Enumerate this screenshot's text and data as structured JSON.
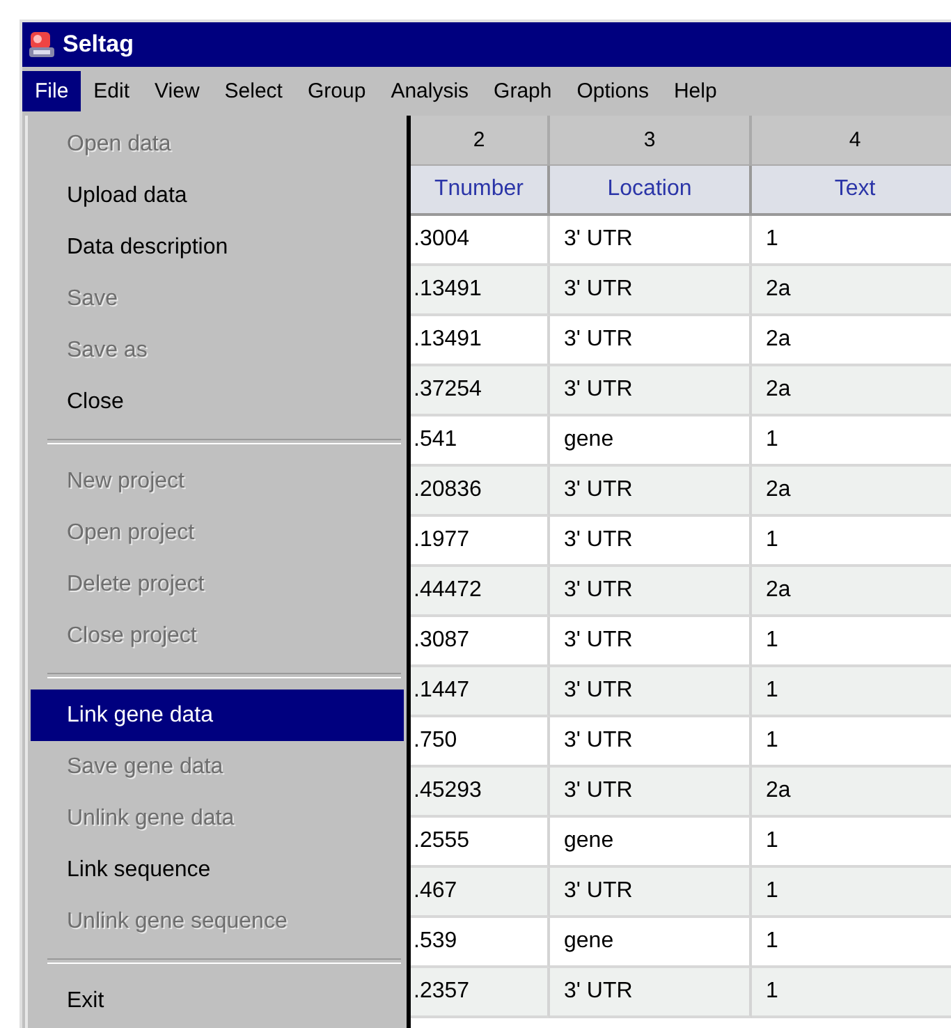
{
  "window": {
    "title": "Seltag"
  },
  "menubar": [
    {
      "label": "File",
      "selected": true
    },
    {
      "label": "Edit",
      "selected": false
    },
    {
      "label": "View",
      "selected": false
    },
    {
      "label": "Select",
      "selected": false
    },
    {
      "label": "Group",
      "selected": false
    },
    {
      "label": "Analysis",
      "selected": false
    },
    {
      "label": "Graph",
      "selected": false
    },
    {
      "label": "Options",
      "selected": false
    },
    {
      "label": "Help",
      "selected": false
    }
  ],
  "file_menu": [
    {
      "kind": "item",
      "label": "Open data",
      "disabled": true,
      "selected": false
    },
    {
      "kind": "item",
      "label": "Upload data",
      "disabled": false,
      "selected": false
    },
    {
      "kind": "item",
      "label": "Data description",
      "disabled": false,
      "selected": false
    },
    {
      "kind": "item",
      "label": "Save",
      "disabled": true,
      "selected": false
    },
    {
      "kind": "item",
      "label": "Save as",
      "disabled": true,
      "selected": false
    },
    {
      "kind": "item",
      "label": "Close",
      "disabled": false,
      "selected": false
    },
    {
      "kind": "separator"
    },
    {
      "kind": "item",
      "label": "New project",
      "disabled": true,
      "selected": false
    },
    {
      "kind": "item",
      "label": "Open project",
      "disabled": true,
      "selected": false
    },
    {
      "kind": "item",
      "label": "Delete project",
      "disabled": true,
      "selected": false
    },
    {
      "kind": "item",
      "label": "Close project",
      "disabled": true,
      "selected": false
    },
    {
      "kind": "separator"
    },
    {
      "kind": "item",
      "label": "Link gene data",
      "disabled": false,
      "selected": true
    },
    {
      "kind": "item",
      "label": "Save gene data",
      "disabled": true,
      "selected": false
    },
    {
      "kind": "item",
      "label": "Unlink gene data",
      "disabled": true,
      "selected": false
    },
    {
      "kind": "item",
      "label": "Link sequence",
      "disabled": false,
      "selected": false
    },
    {
      "kind": "item",
      "label": "Unlink gene sequence",
      "disabled": true,
      "selected": false
    },
    {
      "kind": "separator"
    },
    {
      "kind": "item",
      "label": "Exit",
      "disabled": false,
      "selected": false
    }
  ],
  "table": {
    "column_numbers": [
      "2",
      "3",
      "4"
    ],
    "columns": [
      "Tnumber",
      "Location",
      "Text"
    ],
    "rows": [
      [
        ".3004",
        "3' UTR",
        "1"
      ],
      [
        ".13491",
        "3' UTR",
        "2a"
      ],
      [
        ".13491",
        "3' UTR",
        "2a"
      ],
      [
        ".37254",
        "3' UTR",
        "2a"
      ],
      [
        ".541",
        "gene",
        "1"
      ],
      [
        ".20836",
        "3' UTR",
        "2a"
      ],
      [
        ".1977",
        "3' UTR",
        "1"
      ],
      [
        ".44472",
        "3' UTR",
        "2a"
      ],
      [
        ".3087",
        "3' UTR",
        "1"
      ],
      [
        ".1447",
        "3' UTR",
        "1"
      ],
      [
        ".750",
        "3' UTR",
        "1"
      ],
      [
        ".45293",
        "3' UTR",
        "2a"
      ],
      [
        ".2555",
        "gene",
        "1"
      ],
      [
        ".467",
        "3' UTR",
        "1"
      ],
      [
        ".539",
        "gene",
        "1"
      ],
      [
        ".2357",
        "3' UTR",
        "1"
      ]
    ]
  }
}
